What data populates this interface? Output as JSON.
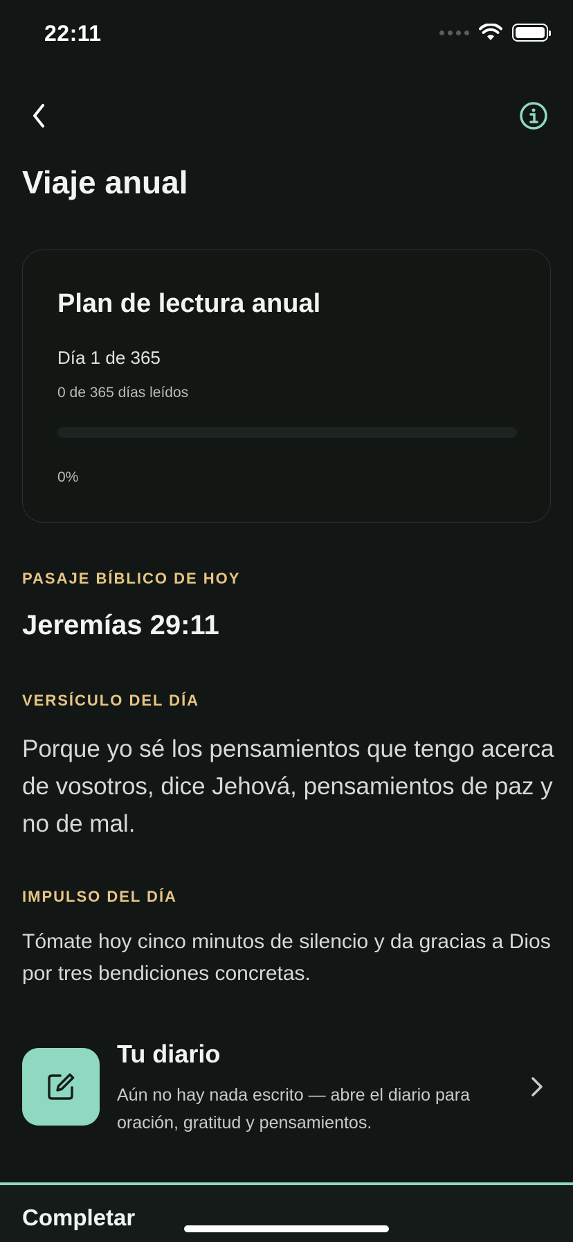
{
  "status_bar": {
    "time": "22:11"
  },
  "header": {
    "title": "Viaje anual"
  },
  "plan": {
    "title": "Plan de lectura anual",
    "day_label": "Día 1 de 365",
    "read_label": "0 de 365 días leídos",
    "progress_fraction": 0,
    "percent_label": "0%"
  },
  "passage": {
    "section_label": "PASAJE BÍBLICO DE HOY",
    "reference": "Jeremías 29:11"
  },
  "verse": {
    "section_label": "VERSÍCULO DEL DÍA",
    "text": "Porque yo sé los pensamientos que tengo acerca de vosotros, dice Jehová, pensamientos de paz y no de mal."
  },
  "impulse": {
    "section_label": "IMPULSO DEL DÍA",
    "text": "Tómate hoy cinco minutos de silencio y da gracias a Dios por tres bendiciones concretas."
  },
  "diary": {
    "title": "Tu diario",
    "description": "Aún no hay nada escrito — abre el diario para oración, gratitud y pensamientos."
  },
  "bottom": {
    "complete_label": "Completar"
  },
  "colors": {
    "accent": "#8fd8c2",
    "section_label": "#e6c684",
    "background": "#121614"
  },
  "icons": {
    "back": "chevron-left-icon",
    "info": "info-circle-icon",
    "diary": "edit-note-icon",
    "diary_chevron": "chevron-right-icon"
  }
}
